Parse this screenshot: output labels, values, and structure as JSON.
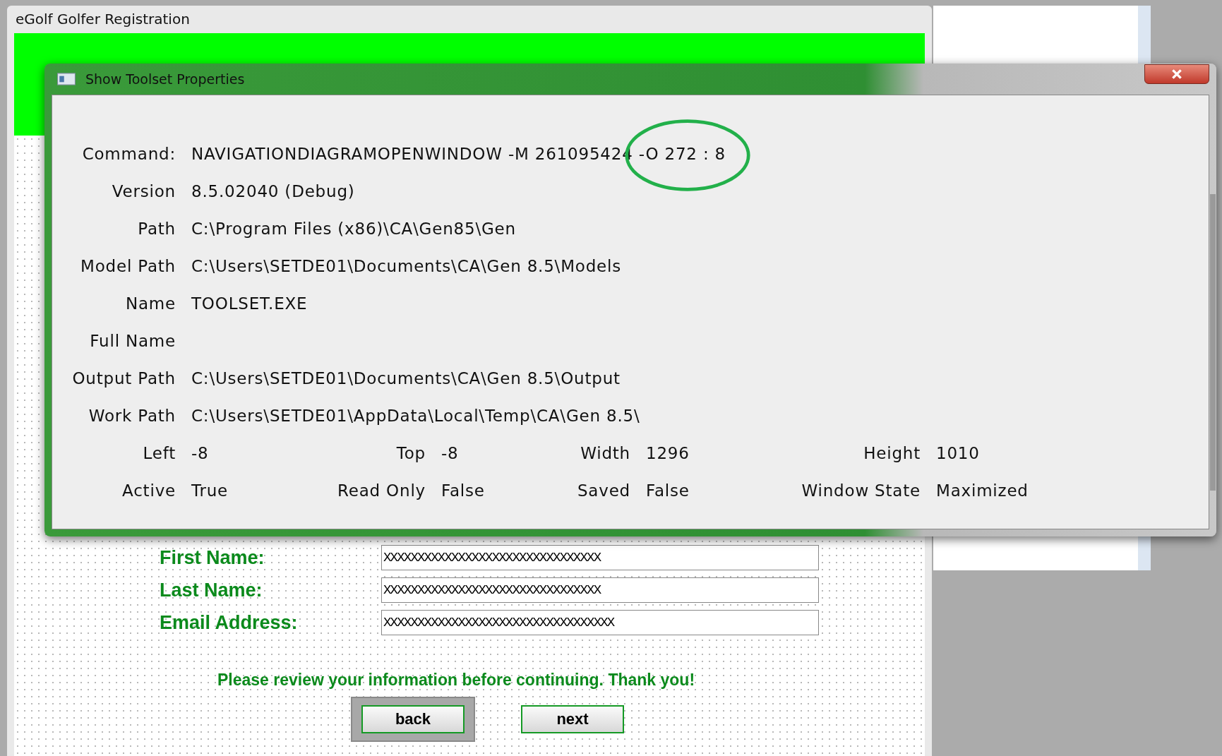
{
  "window": {
    "title": "eGolf Golfer Registration"
  },
  "form": {
    "fields": [
      {
        "label": "First Name:",
        "value": "XXXXXXXXXXXXXXXXXXXXXXXXXXXXXXXX"
      },
      {
        "label": "Last Name:",
        "value": "XXXXXXXXXXXXXXXXXXXXXXXXXXXXXXXX"
      },
      {
        "label": "Email Address:",
        "value": "XXXXXXXXXXXXXXXXXXXXXXXXXXXXXXXXXX"
      }
    ],
    "message": "Please review your information before continuing.  Thank you!",
    "buttons": [
      {
        "label": "back",
        "focused": true
      },
      {
        "label": "next",
        "focused": false
      }
    ]
  },
  "dialog": {
    "title": "Show Toolset Properties",
    "properties": [
      {
        "label": "Command:",
        "value": "NAVIGATIONDIAGRAMOPENWINDOW -M 261095424 -O 272 : 8"
      },
      {
        "label": "Version",
        "value": "8.5.02040 (Debug)"
      },
      {
        "label": "Path",
        "value": "C:\\Program Files (x86)\\CA\\Gen85\\Gen"
      },
      {
        "label": "Model Path",
        "value": "C:\\Users\\SETDE01\\Documents\\CA\\Gen 8.5\\Models"
      },
      {
        "label": "Name",
        "value": "TOOLSET.EXE"
      },
      {
        "label": "Full Name"
      },
      {
        "label": "Output Path",
        "value": "C:\\Users\\SETDE01\\Documents\\CA\\Gen 8.5\\Output"
      },
      {
        "label": "Work Path",
        "value": "C:\\Users\\SETDE01\\AppData\\Local\\Temp\\CA\\Gen 8.5\\"
      }
    ],
    "grid": [
      [
        {
          "label": "Left",
          "value": "-8"
        },
        {
          "label": "Top",
          "value": "-8"
        },
        {
          "label": "Width",
          "value": "1296"
        },
        {
          "label": "Height",
          "value": "1010"
        }
      ],
      [
        {
          "label": "Active",
          "value": "True"
        },
        {
          "label": "Read Only",
          "value": "False"
        },
        {
          "label": "Saved",
          "value": "False"
        },
        {
          "label": "Window State",
          "value": "Maximized"
        }
      ]
    ]
  }
}
